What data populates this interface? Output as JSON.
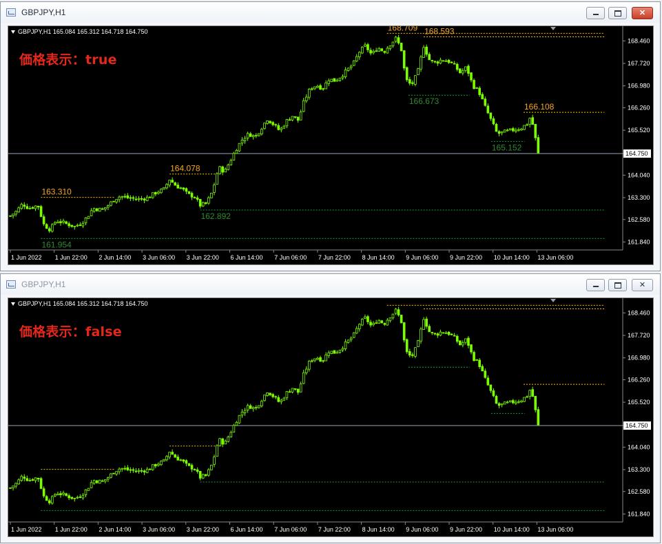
{
  "colors": {
    "background": "#000000",
    "candle": "#7cfc00",
    "high_line": "#ffc000",
    "low_line": "#1f9e3a",
    "high_label": "#f5a623",
    "low_label": "#2e8b2e",
    "bid_line": "#9aa6b8",
    "overlay_text": "#e5271c"
  },
  "windows": [
    {
      "title": "GBPJPY,H1",
      "symbol_info": "GBPJPY,H1  165.084 165.312 164.718 164.750",
      "overlay_label": "価格表示：true",
      "show_prices": true,
      "controls": {
        "minimize": "minimize",
        "maximize": "maximize",
        "close": "✕"
      }
    },
    {
      "title": "GBPJPY,H1",
      "symbol_info": "GBPJPY,H1  165.084 165.312 164.718 164.750",
      "overlay_label": "価格表示：false",
      "show_prices": false,
      "controls": {
        "minimize": "minimize",
        "maximize": "maximize",
        "close": "✕"
      }
    }
  ],
  "chart_data": {
    "type": "candlestick",
    "symbol": "GBPJPY",
    "timeframe": "H1",
    "ylim": [
      161.6,
      168.9
    ],
    "y_ticks": [
      "168.460",
      "167.720",
      "166.980",
      "166.260",
      "165.520",
      "164.750",
      "164.040",
      "163.300",
      "162.580",
      "161.840"
    ],
    "x_ticks": [
      "1 Jun 2022",
      "1 Jun 22:00",
      "2 Jun 14:00",
      "3 Jun 06:00",
      "3 Jun 22:00",
      "6 Jun 14:00",
      "7 Jun 06:00",
      "7 Jun 22:00",
      "8 Jun 14:00",
      "9 Jun 06:00",
      "9 Jun 22:00",
      "10 Jun 14:00",
      "13 Jun 06:00"
    ],
    "current_price": 164.75,
    "current_price_label": "164.750",
    "swing_highs": [
      {
        "price": 163.31,
        "label": "163.310",
        "from": 0.05,
        "to": 0.17
      },
      {
        "price": 164.078,
        "label": "164.078",
        "from": 0.26,
        "to": 0.34
      },
      {
        "price": 168.709,
        "label": "168.709",
        "from": 0.615,
        "to": 0.97
      },
      {
        "price": 168.593,
        "label": "168.593",
        "from": 0.675,
        "to": 0.97
      },
      {
        "price": 166.108,
        "label": "166.108",
        "from": 0.838,
        "to": 0.97
      }
    ],
    "swing_lows": [
      {
        "price": 161.954,
        "label": "161.954",
        "from": 0.05,
        "to": 0.97
      },
      {
        "price": 162.892,
        "label": "162.892",
        "from": 0.31,
        "to": 0.97
      },
      {
        "price": 166.673,
        "label": "166.673",
        "from": 0.65,
        "to": 0.75
      },
      {
        "price": 165.152,
        "label": "165.152",
        "from": 0.785,
        "to": 0.84
      }
    ],
    "close_path": [
      [
        0.0,
        162.7
      ],
      [
        0.01,
        162.85
      ],
      [
        0.02,
        163.1
      ],
      [
        0.03,
        162.95
      ],
      [
        0.045,
        163.05
      ],
      [
        0.055,
        162.4
      ],
      [
        0.065,
        162.25
      ],
      [
        0.075,
        162.55
      ],
      [
        0.09,
        162.45
      ],
      [
        0.105,
        162.35
      ],
      [
        0.115,
        162.45
      ],
      [
        0.125,
        162.65
      ],
      [
        0.135,
        162.95
      ],
      [
        0.15,
        162.9
      ],
      [
        0.16,
        163.05
      ],
      [
        0.17,
        163.25
      ],
      [
        0.18,
        163.35
      ],
      [
        0.195,
        163.28
      ],
      [
        0.21,
        163.25
      ],
      [
        0.225,
        163.3
      ],
      [
        0.24,
        163.5
      ],
      [
        0.25,
        163.55
      ],
      [
        0.26,
        163.9
      ],
      [
        0.27,
        163.7
      ],
      [
        0.28,
        163.6
      ],
      [
        0.29,
        163.4
      ],
      [
        0.3,
        163.35
      ],
      [
        0.31,
        163.05
      ],
      [
        0.32,
        163.1
      ],
      [
        0.33,
        163.5
      ],
      [
        0.34,
        164.3
      ],
      [
        0.35,
        164.15
      ],
      [
        0.36,
        164.55
      ],
      [
        0.37,
        164.95
      ],
      [
        0.38,
        165.25
      ],
      [
        0.39,
        165.4
      ],
      [
        0.4,
        165.3
      ],
      [
        0.41,
        165.6
      ],
      [
        0.42,
        165.9
      ],
      [
        0.43,
        165.7
      ],
      [
        0.44,
        165.5
      ],
      [
        0.45,
        165.8
      ],
      [
        0.46,
        166.0
      ],
      [
        0.47,
        165.85
      ],
      [
        0.48,
        166.5
      ],
      [
        0.49,
        166.9
      ],
      [
        0.5,
        167.0
      ],
      [
        0.51,
        166.9
      ],
      [
        0.52,
        167.2
      ],
      [
        0.53,
        167.15
      ],
      [
        0.54,
        167.3
      ],
      [
        0.55,
        167.5
      ],
      [
        0.56,
        167.7
      ],
      [
        0.57,
        168.1
      ],
      [
        0.58,
        168.3
      ],
      [
        0.59,
        168.0
      ],
      [
        0.6,
        168.25
      ],
      [
        0.61,
        168.1
      ],
      [
        0.62,
        168.35
      ],
      [
        0.63,
        168.55
      ],
      [
        0.64,
        168.1
      ],
      [
        0.645,
        167.2
      ],
      [
        0.655,
        167.0
      ],
      [
        0.665,
        167.4
      ],
      [
        0.675,
        168.3
      ],
      [
        0.685,
        167.8
      ],
      [
        0.695,
        167.75
      ],
      [
        0.705,
        167.85
      ],
      [
        0.715,
        167.8
      ],
      [
        0.725,
        167.65
      ],
      [
        0.735,
        167.4
      ],
      [
        0.745,
        167.6
      ],
      [
        0.755,
        167.0
      ],
      [
        0.765,
        166.8
      ],
      [
        0.775,
        166.3
      ],
      [
        0.785,
        165.85
      ],
      [
        0.795,
        165.4
      ],
      [
        0.805,
        165.45
      ],
      [
        0.815,
        165.5
      ],
      [
        0.825,
        165.55
      ],
      [
        0.835,
        165.6
      ],
      [
        0.845,
        165.75
      ],
      [
        0.85,
        166.0
      ],
      [
        0.855,
        165.5
      ],
      [
        0.862,
        164.75
      ]
    ]
  }
}
